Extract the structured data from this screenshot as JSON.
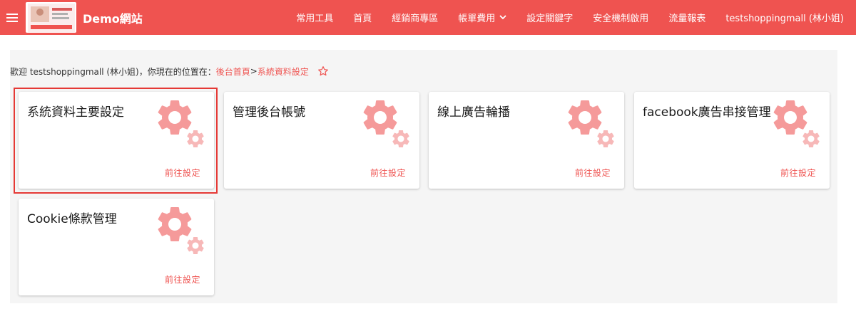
{
  "header": {
    "site_title": "Demo網站",
    "menu_icon": "hamburger-menu-icon",
    "nav": [
      {
        "label": "常用工具"
      },
      {
        "label": "首頁"
      },
      {
        "label": "經銷商專區"
      },
      {
        "label": "帳單費用",
        "dropdown": true
      },
      {
        "label": "設定關鍵字"
      },
      {
        "label": "安全機制啟用"
      },
      {
        "label": "流量報表"
      },
      {
        "label": "testshoppingmall (林小姐)"
      }
    ]
  },
  "breadcrumb": {
    "prefix": "歡迎 testshoppingmall (林小姐)，你現在的位置在：",
    "home": "後台首頁",
    "separator": ">",
    "current": "系統資料設定",
    "star_icon": "star-outline-icon"
  },
  "cards": [
    {
      "title": "系統資料主要設定",
      "link": "前往設定",
      "highlighted": true
    },
    {
      "title": "管理後台帳號",
      "link": "前往設定"
    },
    {
      "title": "線上廣告輪播",
      "link": "前往設定"
    },
    {
      "title": "facebook廣告串接管理",
      "link": "前往設定"
    },
    {
      "title": "Cookie條款管理",
      "link": "前往設定"
    }
  ],
  "colors": {
    "brand": "#ef5350",
    "gear_large": "#f59a9a",
    "gear_small": "#f7b8b8",
    "highlight_border": "#e53935",
    "panel_bg": "#f5f5f5"
  }
}
